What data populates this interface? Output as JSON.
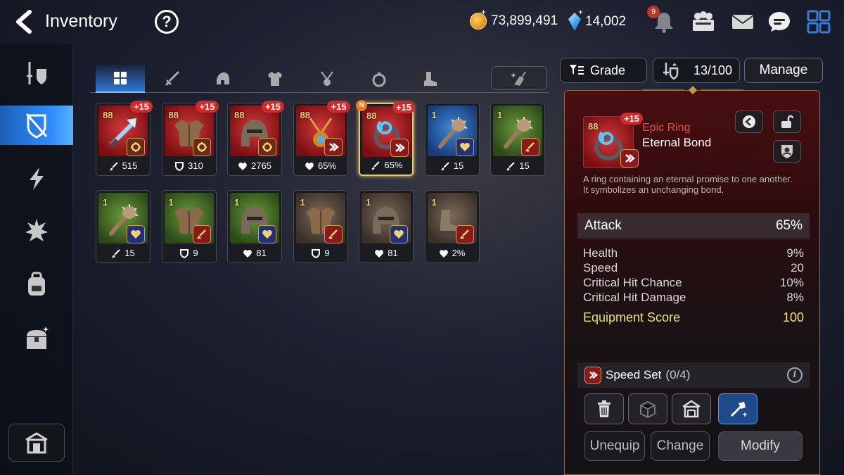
{
  "header": {
    "title": "Inventory",
    "help_label": "?",
    "gold": "73,899,491",
    "crystals": "14,002",
    "notification_count": "9",
    "plus": "+"
  },
  "tabs": [
    {
      "id": "all",
      "icon": "grid-icon",
      "active": true
    },
    {
      "id": "weapon",
      "icon": "sword-icon"
    },
    {
      "id": "helmet",
      "icon": "helmet-icon"
    },
    {
      "id": "armor",
      "icon": "armor-icon"
    },
    {
      "id": "necklace",
      "icon": "necklace-icon"
    },
    {
      "id": "ring",
      "icon": "ring-icon"
    },
    {
      "id": "boots",
      "icon": "boots-icon"
    }
  ],
  "items": [
    {
      "level": "88",
      "enh": "+15",
      "grade": "epic",
      "set": "counter",
      "stat_icon": "attack",
      "stat": "515",
      "art": "weapon"
    },
    {
      "level": "88",
      "enh": "+15",
      "grade": "epic",
      "set": "counter",
      "stat_icon": "defense",
      "stat": "310",
      "art": "armor"
    },
    {
      "level": "88",
      "enh": "+15",
      "grade": "epic",
      "set": "counter",
      "stat_icon": "health",
      "stat": "2765",
      "art": "helmet"
    },
    {
      "level": "88",
      "enh": "+15",
      "grade": "epic",
      "set": "speed",
      "stat_icon": "health",
      "stat": "65%",
      "art": "necklace"
    },
    {
      "level": "88",
      "enh": "+15",
      "grade": "epic",
      "set": "speed",
      "stat_icon": "attack",
      "stat": "65%",
      "art": "ring",
      "new": "N",
      "selected": true
    },
    {
      "level": "1",
      "enh": "",
      "grade": "rare",
      "set": "health",
      "stat_icon": "attack",
      "stat": "15",
      "art": "club"
    },
    {
      "level": "1",
      "enh": "",
      "grade": "common",
      "set": "attack",
      "stat_icon": "attack",
      "stat": "15",
      "art": "club"
    },
    {
      "level": "1",
      "enh": "",
      "grade": "common",
      "set": "health",
      "stat_icon": "attack",
      "stat": "15",
      "art": "club"
    },
    {
      "level": "1",
      "enh": "",
      "grade": "common",
      "set": "attack",
      "stat_icon": "defense",
      "stat": "9",
      "art": "armor"
    },
    {
      "level": "1",
      "enh": "",
      "grade": "common",
      "set": "health",
      "stat_icon": "health",
      "stat": "81",
      "art": "helmet"
    },
    {
      "level": "1",
      "enh": "",
      "grade": "normal",
      "set": "attack",
      "stat_icon": "defense",
      "stat": "9",
      "art": "armor"
    },
    {
      "level": "1",
      "enh": "",
      "grade": "normal",
      "set": "health",
      "stat_icon": "health",
      "stat": "81",
      "art": "helmet"
    },
    {
      "level": "1",
      "enh": "",
      "grade": "normal",
      "set": "attack",
      "stat_icon": "health",
      "stat": "2%",
      "art": "boots"
    }
  ],
  "toolbar": {
    "grade_label": "Grade",
    "capacity": "13/100",
    "manage_label": "Manage"
  },
  "detail": {
    "level": "88",
    "enh": "+15",
    "grade": "Epic Ring",
    "name": "Eternal Bond",
    "description_line1": "A ring containing an eternal promise to one another.",
    "description_line2": "It symbolizes an unchanging bond.",
    "main_stat": {
      "label": "Attack",
      "value": "65%"
    },
    "sub_stats": [
      {
        "label": "Health",
        "value": "9%"
      },
      {
        "label": "Speed",
        "value": "20"
      },
      {
        "label": "Critical Hit Chance",
        "value": "10%"
      },
      {
        "label": "Critical Hit Damage",
        "value": "8%"
      }
    ],
    "score": {
      "label": "Equipment Score",
      "value": "100"
    },
    "set": {
      "name": "Speed Set",
      "progress": "(0/4)"
    },
    "buttons": {
      "unequip": "Unequip",
      "change": "Change",
      "modify": "Modify"
    }
  },
  "colors": {
    "accent_blue": "#2f8cff",
    "epic_red": "#e84a4a",
    "score_yellow": "#f0e070",
    "enh_badge": "#d02a2a"
  }
}
